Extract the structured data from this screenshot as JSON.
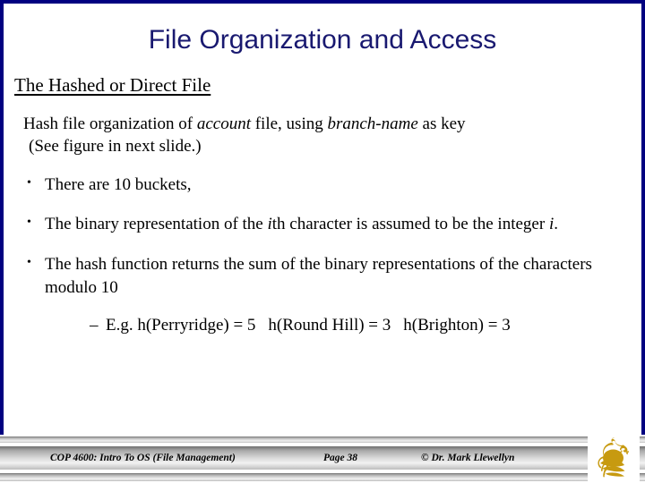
{
  "slide": {
    "title": "File Organization and Access",
    "subtitle": "The Hashed or Direct File",
    "accent_color": "#191970",
    "border_color": "#000080",
    "text_color": "#000000",
    "background_color": "#ffffff",
    "intro": {
      "line1_before": "Hash file organization of ",
      "line1_italic1": "account",
      "line1_middle": " file, using ",
      "line1_italic2": "branch-name",
      "line1_after": " as key",
      "line2": "(See figure in next slide.)"
    },
    "bullets": [
      {
        "marker": "•",
        "before": "There are 10 buckets,",
        "italic": "",
        "after": ""
      },
      {
        "marker": "•",
        "before": "The binary representation of the ",
        "italic": "i",
        "after": "th character is assumed to be the integer ",
        "italic2": "i",
        "tail": "."
      },
      {
        "marker": "•",
        "before": "The hash function returns the sum of the binary representations of the characters modulo 10",
        "italic": "",
        "after": ""
      }
    ],
    "subbullet": {
      "marker": "–",
      "item1": "E.g. h(Perryridge) = 5",
      "item2": "h(Round Hill) = 3",
      "item3": "h(Brighton) = 3"
    }
  },
  "footer": {
    "course": "COP 4600: Intro To OS  (File Management)",
    "page": "Page 38",
    "copyright": "© Dr. Mark Llewellyn",
    "logo_name": "ucf-pegasus-logo",
    "logo_color": "#c79a10"
  }
}
